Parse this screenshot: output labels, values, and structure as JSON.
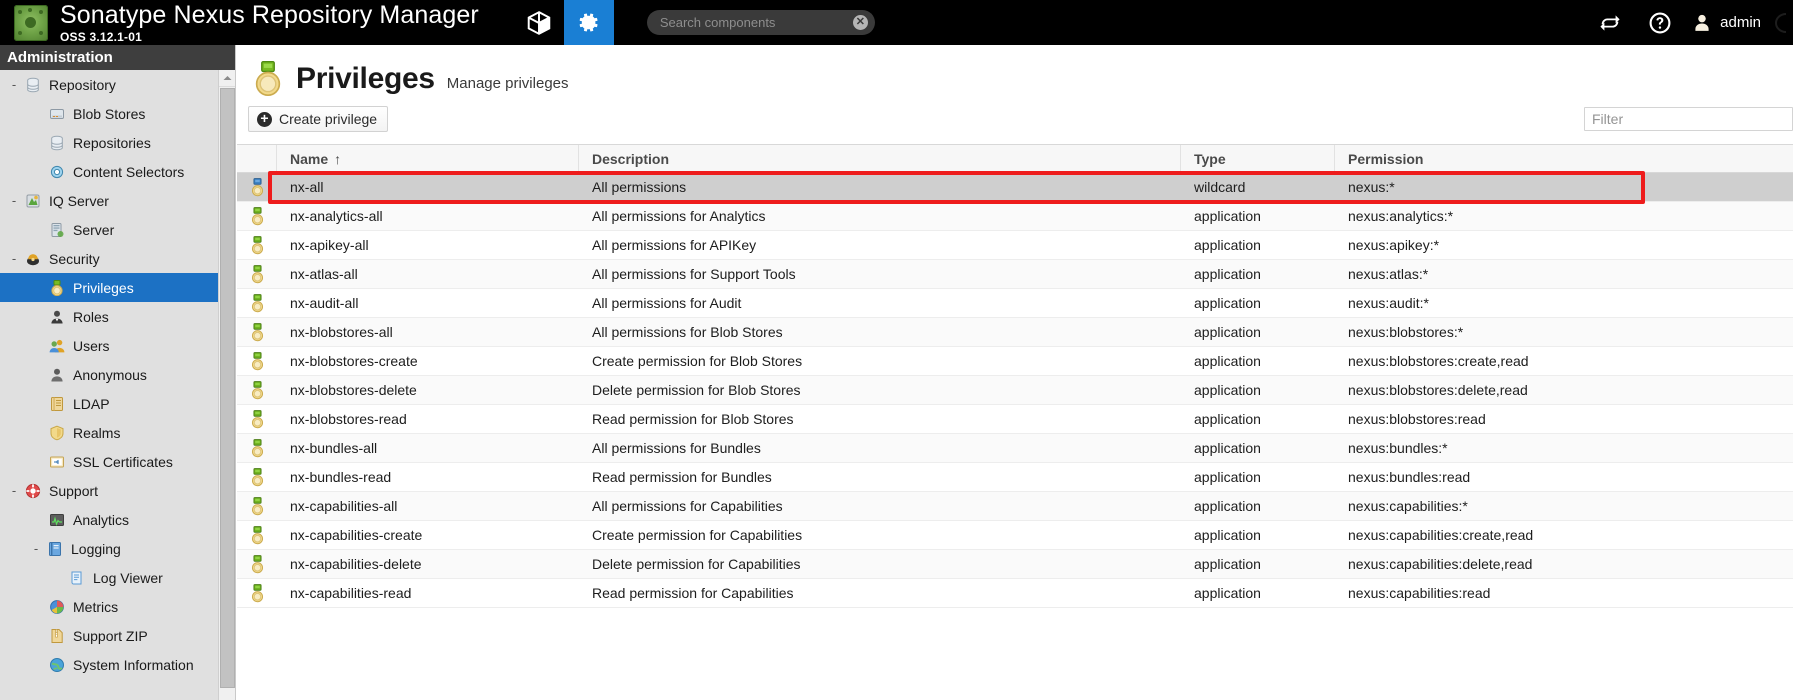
{
  "header": {
    "brand_title": "Sonatype Nexus Repository Manager",
    "brand_subtitle": "OSS 3.12.1-01",
    "browse_icon": "cube-icon",
    "admin_icon": "gear-icon",
    "search": {
      "value": "",
      "placeholder": "Search components"
    },
    "refresh_icon": "refresh-icon",
    "help_icon": "help-icon",
    "user_label": "admin"
  },
  "sidebar": {
    "title": "Administration",
    "items": [
      {
        "label": "Repository",
        "level": 0,
        "toggle": "-",
        "icon": "database-icon",
        "selected": false
      },
      {
        "label": "Blob Stores",
        "level": 1,
        "toggle": "",
        "icon": "blobstore-icon",
        "selected": false
      },
      {
        "label": "Repositories",
        "level": 1,
        "toggle": "",
        "icon": "database-icon",
        "selected": false
      },
      {
        "label": "Content Selectors",
        "level": 1,
        "toggle": "",
        "icon": "selector-icon",
        "selected": false
      },
      {
        "label": "IQ Server",
        "level": 0,
        "toggle": "-",
        "icon": "iq-server-icon",
        "selected": false
      },
      {
        "label": "Server",
        "level": 1,
        "toggle": "",
        "icon": "server-icon",
        "selected": false
      },
      {
        "label": "Security",
        "level": 0,
        "toggle": "-",
        "icon": "security-icon",
        "selected": false
      },
      {
        "label": "Privileges",
        "level": 1,
        "toggle": "",
        "icon": "medal-icon",
        "selected": true
      },
      {
        "label": "Roles",
        "level": 1,
        "toggle": "",
        "icon": "role-icon",
        "selected": false
      },
      {
        "label": "Users",
        "level": 1,
        "toggle": "",
        "icon": "users-icon",
        "selected": false
      },
      {
        "label": "Anonymous",
        "level": 1,
        "toggle": "",
        "icon": "anonymous-icon",
        "selected": false
      },
      {
        "label": "LDAP",
        "level": 1,
        "toggle": "",
        "icon": "ldap-icon",
        "selected": false
      },
      {
        "label": "Realms",
        "level": 1,
        "toggle": "",
        "icon": "realms-icon",
        "selected": false
      },
      {
        "label": "SSL Certificates",
        "level": 1,
        "toggle": "",
        "icon": "certificate-icon",
        "selected": false
      },
      {
        "label": "Support",
        "level": 0,
        "toggle": "-",
        "icon": "lifebuoy-icon",
        "selected": false
      },
      {
        "label": "Analytics",
        "level": 1,
        "toggle": "",
        "icon": "analytics-icon",
        "selected": false
      },
      {
        "label": "Logging",
        "level": 1,
        "toggle": "-",
        "icon": "logging-icon",
        "selected": false
      },
      {
        "label": "Log Viewer",
        "level": 2,
        "toggle": "",
        "icon": "log-viewer-icon",
        "selected": false
      },
      {
        "label": "Metrics",
        "level": 1,
        "toggle": "",
        "icon": "metrics-icon",
        "selected": false
      },
      {
        "label": "Support ZIP",
        "level": 1,
        "toggle": "",
        "icon": "support-zip-icon",
        "selected": false
      },
      {
        "label": "System Information",
        "level": 1,
        "toggle": "",
        "icon": "system-info-icon",
        "selected": false
      }
    ]
  },
  "page": {
    "title": "Privileges",
    "subtitle": "Manage privileges",
    "icon": "medal-icon",
    "create_button": "Create privilege",
    "filter": {
      "value": "",
      "placeholder": "Filter"
    }
  },
  "grid": {
    "columns": [
      {
        "key": "icon",
        "label": ""
      },
      {
        "key": "name",
        "label": "Name",
        "sort": "↑"
      },
      {
        "key": "description",
        "label": "Description",
        "sort": ""
      },
      {
        "key": "type",
        "label": "Type",
        "sort": ""
      },
      {
        "key": "permission",
        "label": "Permission",
        "sort": ""
      }
    ],
    "rows": [
      {
        "name": "nx-all",
        "description": "All permissions",
        "type": "wildcard",
        "permission": "nexus:*",
        "selected": true
      },
      {
        "name": "nx-analytics-all",
        "description": "All permissions for Analytics",
        "type": "application",
        "permission": "nexus:analytics:*",
        "selected": false
      },
      {
        "name": "nx-apikey-all",
        "description": "All permissions for APIKey",
        "type": "application",
        "permission": "nexus:apikey:*",
        "selected": false
      },
      {
        "name": "nx-atlas-all",
        "description": "All permissions for Support Tools",
        "type": "application",
        "permission": "nexus:atlas:*",
        "selected": false
      },
      {
        "name": "nx-audit-all",
        "description": "All permissions for Audit",
        "type": "application",
        "permission": "nexus:audit:*",
        "selected": false
      },
      {
        "name": "nx-blobstores-all",
        "description": "All permissions for Blob Stores",
        "type": "application",
        "permission": "nexus:blobstores:*",
        "selected": false
      },
      {
        "name": "nx-blobstores-create",
        "description": "Create permission for Blob Stores",
        "type": "application",
        "permission": "nexus:blobstores:create,read",
        "selected": false
      },
      {
        "name": "nx-blobstores-delete",
        "description": "Delete permission for Blob Stores",
        "type": "application",
        "permission": "nexus:blobstores:delete,read",
        "selected": false
      },
      {
        "name": "nx-blobstores-read",
        "description": "Read permission for Blob Stores",
        "type": "application",
        "permission": "nexus:blobstores:read",
        "selected": false
      },
      {
        "name": "nx-bundles-all",
        "description": "All permissions for Bundles",
        "type": "application",
        "permission": "nexus:bundles:*",
        "selected": false
      },
      {
        "name": "nx-bundles-read",
        "description": "Read permission for Bundles",
        "type": "application",
        "permission": "nexus:bundles:read",
        "selected": false
      },
      {
        "name": "nx-capabilities-all",
        "description": "All permissions for Capabilities",
        "type": "application",
        "permission": "nexus:capabilities:*",
        "selected": false
      },
      {
        "name": "nx-capabilities-create",
        "description": "Create permission for Capabilities",
        "type": "application",
        "permission": "nexus:capabilities:create,read",
        "selected": false
      },
      {
        "name": "nx-capabilities-delete",
        "description": "Delete permission for Capabilities",
        "type": "application",
        "permission": "nexus:capabilities:delete,read",
        "selected": false
      },
      {
        "name": "nx-capabilities-read",
        "description": "Read permission for Capabilities",
        "type": "application",
        "permission": "nexus:capabilities:read",
        "selected": false
      }
    ]
  },
  "annotation": {
    "highlight_color": "#ee1c1c",
    "highlight_target": "nx-all"
  },
  "colors": {
    "accent": "#1a7fd4",
    "topbar_bg": "#000000",
    "sidebar_bg": "#e0e0e0",
    "selected_row": "#cfcfcf"
  }
}
